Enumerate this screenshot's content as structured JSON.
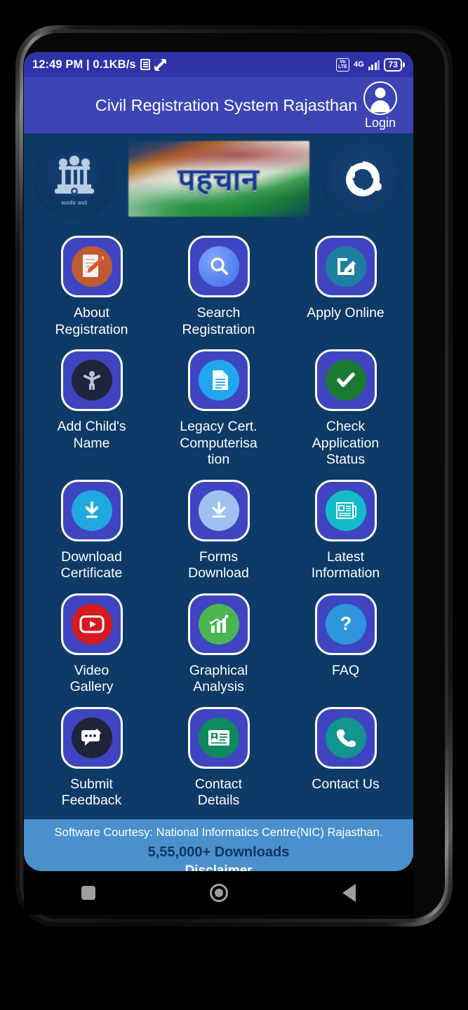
{
  "statusbar": {
    "time_and_speed": "12:49 PM | 0.1KB/s",
    "doc_icon": "document-icon",
    "sync_icon": "sync-icon",
    "volte_label_top": "Vo",
    "volte_label_bottom": "LTE",
    "network": "4G",
    "battery": "73"
  },
  "appbar": {
    "title": "Civil Registration System Rajasthan",
    "login_label": "Login",
    "avatar_icon": "user-avatar-icon",
    "bg_color": "#3d45b5"
  },
  "banner": {
    "emblem_motto": "सत्यमेव जयते",
    "emblem_name": "india-national-emblem",
    "center_text": "पहचान",
    "right_logo_name": "rajasthan-govt-logo"
  },
  "grid": {
    "tile_bg": "#3f45c0",
    "page_bg": "#0d3a66",
    "items": [
      {
        "label": "About\nRegistration",
        "icon": "about-registration-icon",
        "icon_color": "#c05a32"
      },
      {
        "label": "Search\nRegistration",
        "icon": "search-icon",
        "icon_color": "#5b86f5"
      },
      {
        "label": "Apply Online",
        "icon": "apply-online-edit-icon",
        "icon_color": "#1f7fa0"
      },
      {
        "label": "Add Child's\nName",
        "icon": "add-child-name-icon",
        "icon_color": "#1f2235"
      },
      {
        "label": "Legacy Cert.\nComputerisa\ntion",
        "icon": "legacy-certificate-icon",
        "icon_color": "#21a6ef"
      },
      {
        "label": "Check\nApplication\nStatus",
        "icon": "check-status-icon",
        "icon_color": "#1a7a33"
      },
      {
        "label": "Download\nCertificate",
        "icon": "download-certificate-icon",
        "icon_color": "#22a8e0"
      },
      {
        "label": "Forms\nDownload",
        "icon": "forms-download-icon",
        "icon_color": "#9fc1f2"
      },
      {
        "label": "Latest\nInformation",
        "icon": "latest-information-news-icon",
        "icon_color": "#12bcc8"
      },
      {
        "label": "Video\nGallery",
        "icon": "video-gallery-youtube-icon",
        "icon_color": "#d71920"
      },
      {
        "label": "Graphical\nAnalysis",
        "icon": "graphical-analysis-chart-icon",
        "icon_color": "#4bb552"
      },
      {
        "label": "FAQ",
        "icon": "faq-question-icon",
        "icon_color": "#2f95dd"
      },
      {
        "label": "Submit\nFeedback",
        "icon": "submit-feedback-icon",
        "icon_color": "#1f2235"
      },
      {
        "label": "Contact\nDetails",
        "icon": "contact-details-card-icon",
        "icon_color": "#0f8a5f"
      },
      {
        "label": "Contact Us",
        "icon": "contact-us-phone-icon",
        "icon_color": "#13958f"
      }
    ]
  },
  "footer": {
    "courtesy": "Software Courtesy: National Informatics Centre(NIC) Rajasthan.",
    "downloads": "5,55,000+ Downloads",
    "disclaimer": "Disclaimer",
    "bg_color": "#4a90cc"
  },
  "navbar": {
    "recents": "recents-square-icon",
    "home": "home-circle-icon",
    "back": "back-triangle-icon"
  }
}
